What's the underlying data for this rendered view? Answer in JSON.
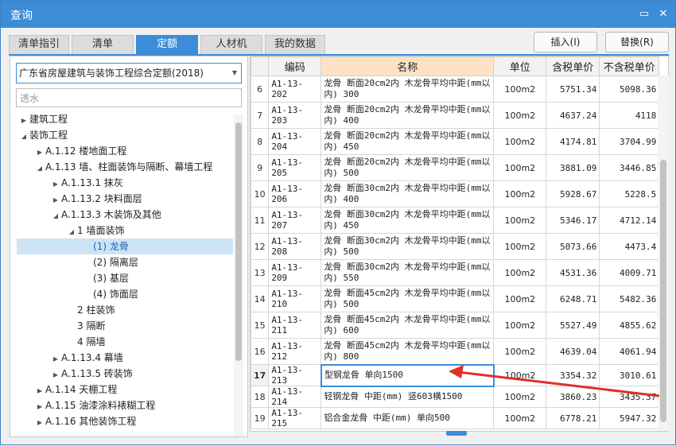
{
  "window": {
    "title": "查询",
    "accent": "#3c8dd6"
  },
  "tabs": [
    {
      "label": "清单指引",
      "active": false
    },
    {
      "label": "清单",
      "active": false
    },
    {
      "label": "定额",
      "active": true
    },
    {
      "label": "人材机",
      "active": false
    },
    {
      "label": "我的数据",
      "active": false
    }
  ],
  "actions": {
    "insert_label": "插入(I)",
    "replace_label": "替换(R)"
  },
  "left": {
    "library": "广东省房屋建筑与装饰工程综合定额(2018)",
    "search_value": "透水"
  },
  "tree": [
    {
      "label": "建筑工程",
      "arrow": "right"
    },
    {
      "label": "装饰工程",
      "arrow": "down"
    },
    {
      "label": "A.1.12 楼地面工程",
      "arrow": "right"
    },
    {
      "label": "A.1.13 墙、柱面装饰与隔断、幕墙工程",
      "arrow": "down"
    },
    {
      "label": "A.1.13.1 抹灰",
      "arrow": "right"
    },
    {
      "label": "A.1.13.2 块料面层",
      "arrow": "right"
    },
    {
      "label": "A.1.13.3 木装饰及其他",
      "arrow": "down"
    },
    {
      "label": "1 墙面装饰",
      "arrow": "down"
    },
    {
      "label": "(1) 龙骨",
      "arrow": "",
      "selected": true
    },
    {
      "label": "(2) 隔离层",
      "arrow": ""
    },
    {
      "label": "(3) 基层",
      "arrow": ""
    },
    {
      "label": "(4) 饰面层",
      "arrow": ""
    },
    {
      "label": "2 柱装饰",
      "arrow": ""
    },
    {
      "label": "3 隔断",
      "arrow": ""
    },
    {
      "label": "4 隔墙",
      "arrow": ""
    },
    {
      "label": "A.1.13.4 幕墙",
      "arrow": "right"
    },
    {
      "label": "A.1.13.5 砖装饰",
      "arrow": "right"
    },
    {
      "label": "A.1.14 天棚工程",
      "arrow": "right"
    },
    {
      "label": "A.1.15 油漆涂料裱糊工程",
      "arrow": "right"
    },
    {
      "label": "A.1.16 其他装饰工程",
      "arrow": "right"
    }
  ],
  "grid": {
    "headers": [
      "",
      "编码",
      "名称",
      "单位",
      "含税单价",
      "不含税单价"
    ],
    "rows": [
      {
        "n": "6",
        "code": "A1-13-202",
        "name": "龙骨 断面20cm2内 木龙骨平均中距(mm以内) 300",
        "unit": "100m2",
        "tax": "5751.34",
        "notax": "5098.36"
      },
      {
        "n": "7",
        "code": "A1-13-203",
        "name": "龙骨 断面20cm2内 木龙骨平均中距(mm以内) 400",
        "unit": "100m2",
        "tax": "4637.24",
        "notax": "4118"
      },
      {
        "n": "8",
        "code": "A1-13-204",
        "name": "龙骨 断面20cm2内 木龙骨平均中距(mm以内) 450",
        "unit": "100m2",
        "tax": "4174.81",
        "notax": "3704.99"
      },
      {
        "n": "9",
        "code": "A1-13-205",
        "name": "龙骨 断面20cm2内 木龙骨平均中距(mm以内) 500",
        "unit": "100m2",
        "tax": "3881.09",
        "notax": "3446.85"
      },
      {
        "n": "10",
        "code": "A1-13-206",
        "name": "龙骨 断面30cm2内 木龙骨平均中距(mm以内) 400",
        "unit": "100m2",
        "tax": "5928.67",
        "notax": "5228.5"
      },
      {
        "n": "11",
        "code": "A1-13-207",
        "name": "龙骨 断面30cm2内 木龙骨平均中距(mm以内) 450",
        "unit": "100m2",
        "tax": "5346.17",
        "notax": "4712.14"
      },
      {
        "n": "12",
        "code": "A1-13-208",
        "name": "龙骨 断面30cm2内 木龙骨平均中距(mm以内) 500",
        "unit": "100m2",
        "tax": "5073.66",
        "notax": "4473.4"
      },
      {
        "n": "13",
        "code": "A1-13-209",
        "name": "龙骨 断面30cm2内 木龙骨平均中距(mm以内) 550",
        "unit": "100m2",
        "tax": "4531.36",
        "notax": "4009.71"
      },
      {
        "n": "14",
        "code": "A1-13-210",
        "name": "龙骨 断面45cm2内 木龙骨平均中距(mm以内) 500",
        "unit": "100m2",
        "tax": "6248.71",
        "notax": "5482.36"
      },
      {
        "n": "15",
        "code": "A1-13-211",
        "name": "龙骨 断面45cm2内 木龙骨平均中距(mm以内) 600",
        "unit": "100m2",
        "tax": "5527.49",
        "notax": "4855.62"
      },
      {
        "n": "16",
        "code": "A1-13-212",
        "name": "龙骨 断面45cm2内 木龙骨平均中距(mm以内) 800",
        "unit": "100m2",
        "tax": "4639.04",
        "notax": "4061.94"
      },
      {
        "n": "17",
        "code": "A1-13-213",
        "name": "型钢龙骨 单向1500",
        "unit": "100m2",
        "tax": "3354.32",
        "notax": "3010.61",
        "selected": true
      },
      {
        "n": "18",
        "code": "A1-13-214",
        "name": "轻钢龙骨 中距(mm) 竖603横1500",
        "unit": "100m2",
        "tax": "3860.23",
        "notax": "3435.37"
      },
      {
        "n": "19",
        "code": "A1-13-215",
        "name": "铝合金龙骨 中距(mm) 单向500",
        "unit": "100m2",
        "tax": "6778.21",
        "notax": "5947.32"
      }
    ]
  },
  "annotation_color": "#e0302a"
}
